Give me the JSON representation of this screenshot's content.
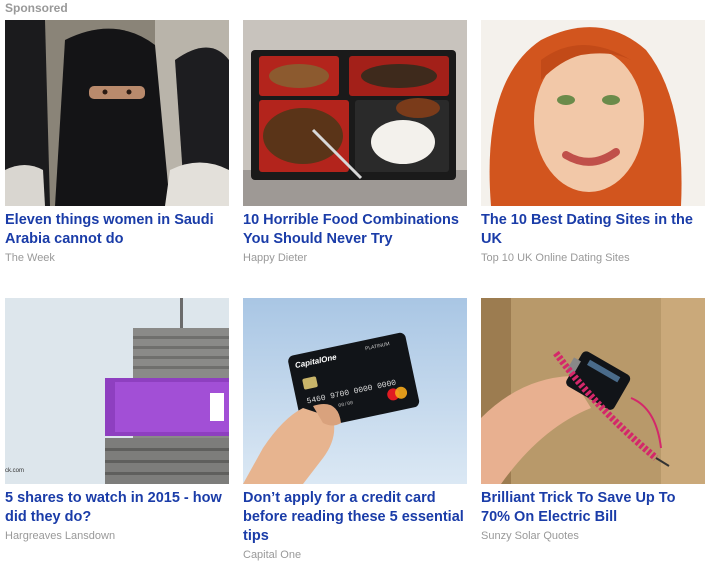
{
  "header": {
    "label": "Sponsored"
  },
  "items": [
    {
      "title": "Eleven things women in Saudi Arabia cannot do",
      "source": "The Week"
    },
    {
      "title": "10 Horrible Food Combinations You Should Never Try",
      "source": "Happy Dieter"
    },
    {
      "title": "The 10 Best Dating Sites in the UK",
      "source": "Top 10 UK Online Dating Sites"
    },
    {
      "title": "5 shares to watch in 2015 - how did they do?",
      "source": "Hargreaves Lansdown",
      "image_caption": "ck.com"
    },
    {
      "title": "Don’t apply for a credit card before reading these 5 essential tips",
      "source": "Capital One",
      "card_text": {
        "brand": "CapitalOne",
        "tier": "PLATINUM",
        "number": "5460 9700 0000 0000",
        "expiry": "00/00"
      }
    },
    {
      "title": "Brilliant Trick To Save Up To 70% On Electric Bill",
      "source": "Sunzy Solar Quotes"
    }
  ]
}
